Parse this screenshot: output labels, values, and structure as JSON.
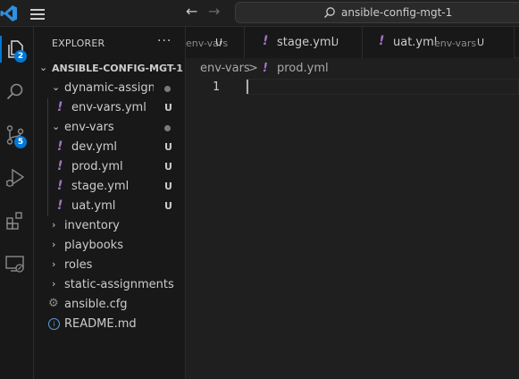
{
  "titlebar": {
    "search_text": "ansible-config-mgt-1"
  },
  "activitybar": {
    "explorer_badge": "2",
    "source_control_badge": "5",
    "accent_color": "#0078d4"
  },
  "sidebar": {
    "title": "EXPLORER",
    "more": "···",
    "project": "ANSIBLE-CONFIG-MGT-1",
    "items": [
      {
        "name": "dynamic-assignments",
        "display": "dynamic-assign...",
        "kind": "folder-open",
        "status": "dot"
      },
      {
        "name": "env-vars.yml",
        "kind": "yaml",
        "status": "U"
      },
      {
        "name": "env-vars",
        "kind": "folder-open",
        "status": "dot"
      },
      {
        "name": "dev.yml",
        "kind": "yaml",
        "status": "U"
      },
      {
        "name": "prod.yml",
        "kind": "yaml",
        "status": "U"
      },
      {
        "name": "stage.yml",
        "kind": "yaml",
        "status": "U"
      },
      {
        "name": "uat.yml",
        "kind": "yaml",
        "status": "U"
      },
      {
        "name": "inventory",
        "kind": "folder-closed"
      },
      {
        "name": "playbooks",
        "kind": "folder-closed"
      },
      {
        "name": "roles",
        "kind": "folder-closed"
      },
      {
        "name": "static-assignments",
        "kind": "folder-closed"
      },
      {
        "name": "ansible.cfg",
        "kind": "config"
      },
      {
        "name": "README.md",
        "kind": "info"
      }
    ]
  },
  "tabs": [
    {
      "name": "env-vars",
      "status": "U",
      "partial": true
    },
    {
      "name": "stage.yml",
      "status": "U"
    },
    {
      "name": "uat.yml",
      "description": "env-vars",
      "status": "U"
    }
  ],
  "breadcrumb": {
    "folder": "env-vars",
    "separator": ">",
    "file": "prod.yml"
  },
  "editor": {
    "line_number": "1"
  }
}
